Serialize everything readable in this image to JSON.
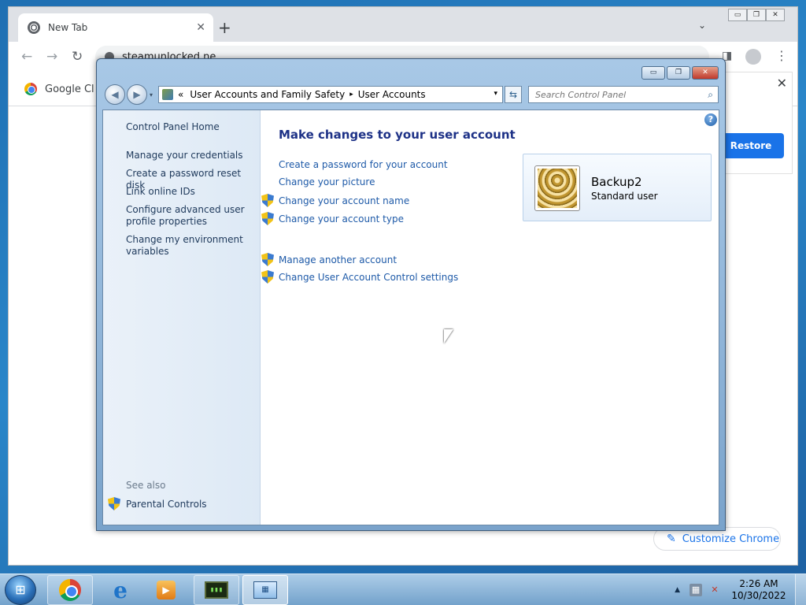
{
  "chrome": {
    "tab_title": "New Tab",
    "tab_close": "✕",
    "new_tab": "+",
    "tab_search": "⌄",
    "window_controls": [
      "▭",
      "❐",
      "✕"
    ],
    "back": "←",
    "forward": "→",
    "reload": "↻",
    "url": "steamunlocked.ne",
    "sidepanel_icon": "◨",
    "menu_icon": "⋮",
    "bookmark_label": "Google Cl",
    "restore_close": "✕",
    "restore_label": "Restore",
    "customize_icon": "✎",
    "customize_label": "Customize Chrome"
  },
  "control_panel": {
    "title_buttons": [
      "▭",
      "❐",
      "✕"
    ],
    "back_icon": "◀",
    "forward_icon": "▶",
    "nav_dropdown": "▾",
    "breadcrumb_prefix": "«",
    "breadcrumbs": [
      "User Accounts and Family Safety",
      "User Accounts"
    ],
    "crumb_separator": "▸",
    "address_dropdown": "▾",
    "refresh_icon": "⇆",
    "search_placeholder": "Search Control Panel",
    "search_icon_glyph": "⌕",
    "help_glyph": "?",
    "left_pane": {
      "home": "Control Panel Home",
      "links": [
        "Manage your credentials",
        "Create a password reset disk",
        "Link online IDs",
        "Configure advanced user profile properties",
        "Change my environment variables"
      ],
      "see_also_label": "See also",
      "see_also_links": [
        "Parental Controls"
      ]
    },
    "main": {
      "heading": "Make changes to your user account",
      "tasks": [
        "Create a password for your account",
        "Change your picture",
        "Change your account name",
        "Change your account type"
      ],
      "other_tasks": [
        "Manage another account",
        "Change User Account Control settings"
      ]
    },
    "account": {
      "name": "Backup2",
      "type": "Standard user"
    }
  },
  "taskbar": {
    "start_glyph": "⊞",
    "ie_glyph": "e",
    "media_glyph": "▶",
    "taskmgr_glyph": "▮▮▮",
    "cp_glyph": "▦",
    "tray_arrow": "▲",
    "network_glyph": "▦",
    "volume_glyph": "✕",
    "time": "2:26 AM",
    "date": "10/30/2022"
  }
}
